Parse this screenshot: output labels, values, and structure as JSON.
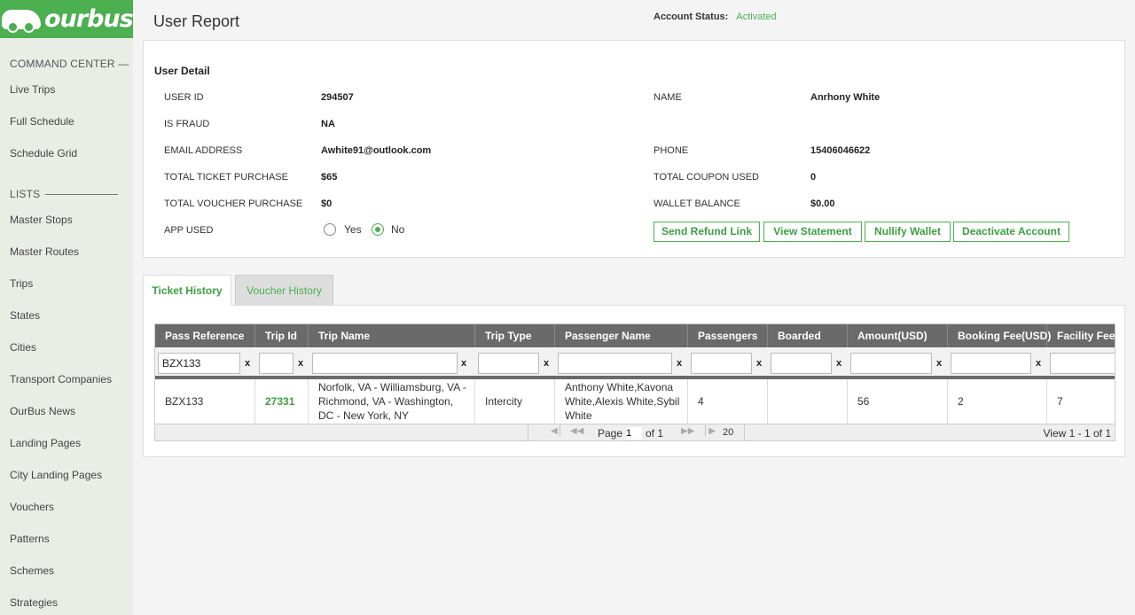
{
  "brand": {
    "name": "ourbus"
  },
  "sidebar": {
    "sections": [
      {
        "label": "COMMAND CENTER —"
      },
      {
        "label": "LISTS"
      }
    ],
    "items": [
      "Live Trips",
      "Full Schedule",
      "Schedule Grid",
      "Master Stops",
      "Master Routes",
      "Trips",
      "States",
      "Cities",
      "Transport Companies",
      "OurBus News",
      "Landing Pages",
      "City Landing Pages",
      "Vouchers",
      "Patterns",
      "Schemes",
      "Strategies"
    ]
  },
  "header": {
    "title": "User Report",
    "account_status_label": "Account Status:",
    "account_status_value": "Activated"
  },
  "user_detail": {
    "title": "User Detail",
    "user_id_label": "USER ID",
    "user_id": "294507",
    "name_label": "NAME",
    "name": "Anrhony White",
    "is_fraud_label": "IS FRAUD",
    "is_fraud": "NA",
    "email_label": "EMAIL ADDRESS",
    "email": "Awhite91@outlook.com",
    "phone_label": "PHONE",
    "phone": "15406046622",
    "total_ticket_label": "TOTAL TICKET PURCHASE",
    "total_ticket": "$65",
    "total_coupon_label": "TOTAL COUPON USED",
    "total_coupon": "0",
    "total_voucher_label": "TOTAL VOUCHER PURCHASE",
    "total_voucher": "$0",
    "wallet_label": "WALLET BALANCE",
    "wallet": "$0.00",
    "app_used_label": "APP USED",
    "app_used_yes": "Yes",
    "app_used_no": "No",
    "app_used_selected": "No"
  },
  "actions": {
    "send_refund": "Send Refund Link",
    "view_statement": "View Statement",
    "nullify_wallet": "Nullify Wallet",
    "deactivate": "Deactivate Account"
  },
  "tabs": [
    {
      "label": "Ticket History",
      "active": true
    },
    {
      "label": "Voucher History",
      "active": false
    }
  ],
  "grid": {
    "columns": [
      "Pass Reference",
      "Trip Id",
      "Trip Name",
      "Trip Type",
      "Passenger Name",
      "Passengers",
      "Boarded",
      "Amount(USD)",
      "Booking Fee(USD)",
      "Facility Fee(U"
    ],
    "filters": [
      "BZX133",
      "",
      "",
      "",
      "",
      "",
      "",
      "",
      "",
      ""
    ],
    "filter_clear": "x",
    "rows": [
      {
        "pass_reference": "BZX133",
        "trip_id": "27331",
        "trip_name": "Norfolk, VA - Williamsburg, VA - Richmond, VA - Washington, DC - New York, NY",
        "trip_type": "Intercity",
        "passenger_name": "Anthony White,Kavona White,Alexis White,Sybil White",
        "passengers": "4",
        "boarded": "",
        "amount": "56",
        "booking_fee": "2",
        "facility_fee": "7"
      }
    ],
    "pager": {
      "page_label": "Page",
      "page_value": "1",
      "of_label": "of 1",
      "rows_per_page": "20",
      "view_text": "View 1 - 1 of 1"
    }
  },
  "colors": {
    "accent": "#4caf50",
    "sidebar_bg": "#e8ede6",
    "grid_header": "#6a6a6a"
  }
}
